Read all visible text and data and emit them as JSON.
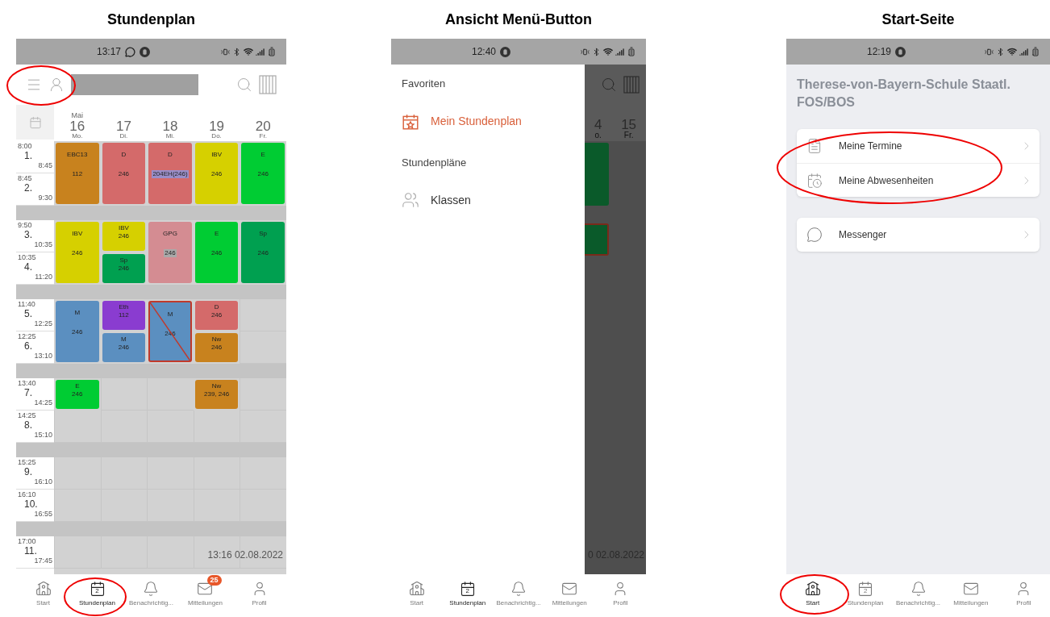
{
  "timetable_screen": {
    "caption": "Stundenplan",
    "status_bar": {
      "time": "13:17",
      "notification_icons": [
        {
          "kind": "chat"
        },
        {
          "kind": "shield"
        }
      ]
    },
    "rows": [
      {
        "kind": "period",
        "start": "8:00",
        "number": "1.",
        "end": "8:45"
      },
      {
        "kind": "period",
        "start": "8:45",
        "number": "2.",
        "end": "9:30"
      },
      {
        "kind": "break"
      },
      {
        "kind": "period",
        "start": "9:50",
        "number": "3.",
        "end": "10:35"
      },
      {
        "kind": "period",
        "start": "10:35",
        "number": "4.",
        "end": "11:20"
      },
      {
        "kind": "break"
      },
      {
        "kind": "period",
        "start": "11:40",
        "number": "5.",
        "end": "12:25"
      },
      {
        "kind": "period",
        "start": "12:25",
        "number": "6.",
        "end": "13:10"
      },
      {
        "kind": "break"
      },
      {
        "kind": "period",
        "start": "13:40",
        "number": "7.",
        "end": "14:25"
      },
      {
        "kind": "period",
        "start": "14:25",
        "number": "8.",
        "end": "15:10"
      },
      {
        "kind": "break"
      },
      {
        "kind": "period",
        "start": "15:25",
        "number": "9.",
        "end": "16:10"
      },
      {
        "kind": "period",
        "start": "16:10",
        "number": "10.",
        "end": "16:55"
      },
      {
        "kind": "break"
      },
      {
        "kind": "period",
        "start": "17:00",
        "number": "11.",
        "end": "17:45"
      }
    ],
    "days": [
      {
        "month": "Mai",
        "date": "16",
        "weekday": "Mo.",
        "slots": [
          {
            "kind": "lesson",
            "subject": "EBC13",
            "room": "112",
            "color": "#c8821e",
            "cancelled": false
          },
          {
            "kind": "continued"
          },
          {
            "kind": "lesson",
            "subject": "IBV",
            "room": "246",
            "color": "#d6d000",
            "cancelled": false
          },
          {
            "kind": "continued"
          },
          {
            "kind": "lesson",
            "subject": "M",
            "room": "246",
            "color": "#5b8fc0",
            "cancelled": false
          },
          {
            "kind": "continued"
          },
          {
            "kind": "lesson",
            "subject": "E",
            "room": "246",
            "color": "#00cc33",
            "cancelled": false
          },
          {
            "kind": "free"
          },
          {
            "kind": "free"
          },
          {
            "kind": "free"
          },
          {
            "kind": "free"
          }
        ]
      },
      {
        "date": "17",
        "weekday": "Di.",
        "slots": [
          {
            "kind": "lesson",
            "subject": "D",
            "room": "246",
            "color": "#d46a6a",
            "cancelled": false
          },
          {
            "kind": "continued"
          },
          {
            "kind": "lesson",
            "subject": "IBV",
            "room": "246",
            "color": "#d6d000",
            "cancelled": false
          },
          {
            "kind": "lesson",
            "subject": "Sp",
            "room": "246",
            "color": "#00a050",
            "cancelled": false
          },
          {
            "kind": "lesson",
            "subject": "Eth",
            "room": "112",
            "color": "#8a3cd0",
            "cancelled": false
          },
          {
            "kind": "lesson",
            "subject": "M",
            "room": "246",
            "color": "#5b8fc0",
            "cancelled": false
          },
          {
            "kind": "free"
          },
          {
            "kind": "free"
          },
          {
            "kind": "free"
          },
          {
            "kind": "free"
          },
          {
            "kind": "free"
          }
        ]
      },
      {
        "date": "18",
        "weekday": "Mi.",
        "slots": [
          {
            "kind": "lesson",
            "subject": "D",
            "room": "204EH(246)",
            "room_changed": true,
            "color": "#d46a6a",
            "cancelled": false
          },
          {
            "kind": "continued"
          },
          {
            "kind": "lesson",
            "subject": "GPG",
            "room": "246",
            "room_marked": true,
            "color": "#d48c92",
            "cancelled": false
          },
          {
            "kind": "continued"
          },
          {
            "kind": "lesson",
            "subject": "M",
            "room": "246",
            "color": "#5b8fc0",
            "cancelled": true
          },
          {
            "kind": "continued"
          },
          {
            "kind": "free"
          },
          {
            "kind": "free"
          },
          {
            "kind": "free"
          },
          {
            "kind": "free"
          },
          {
            "kind": "free"
          }
        ]
      },
      {
        "date": "19",
        "weekday": "Do.",
        "slots": [
          {
            "kind": "lesson",
            "subject": "IBV",
            "room": "246",
            "color": "#d6d000",
            "cancelled": false
          },
          {
            "kind": "continued"
          },
          {
            "kind": "lesson",
            "subject": "E",
            "room": "246",
            "color": "#00cc33",
            "cancelled": false
          },
          {
            "kind": "continued"
          },
          {
            "kind": "lesson",
            "subject": "D",
            "room": "246",
            "color": "#d46a6a",
            "cancelled": false
          },
          {
            "kind": "lesson",
            "subject": "Nw",
            "room": "246",
            "color": "#c8821e",
            "cancelled": false
          },
          {
            "kind": "lesson",
            "subject": "Nw",
            "room": "239, 246",
            "color": "#c8821e",
            "cancelled": false
          },
          {
            "kind": "free"
          },
          {
            "kind": "free"
          },
          {
            "kind": "free"
          },
          {
            "kind": "free"
          }
        ]
      },
      {
        "date": "20",
        "weekday": "Fr.",
        "slots": [
          {
            "kind": "lesson",
            "subject": "E",
            "room": "246",
            "color": "#00cc33",
            "cancelled": false
          },
          {
            "kind": "continued"
          },
          {
            "kind": "lesson",
            "subject": "Sp",
            "room": "246",
            "color": "#00a050",
            "cancelled": false
          },
          {
            "kind": "continued"
          },
          {
            "kind": "free"
          },
          {
            "kind": "free"
          },
          {
            "kind": "free"
          },
          {
            "kind": "free"
          },
          {
            "kind": "free"
          },
          {
            "kind": "free"
          },
          {
            "kind": "free"
          }
        ]
      }
    ],
    "timestamp": "13:16 02.08.2022",
    "tab_bar": [
      {
        "kind": "home",
        "label": "Start",
        "selected": false
      },
      {
        "kind": "calendar",
        "label": "Stundenplan",
        "icon_text": "2",
        "selected": true
      },
      {
        "kind": "bell",
        "label": "Benachrichtig...",
        "selected": false
      },
      {
        "kind": "mail",
        "label": "Mitteilungen",
        "badge": "25",
        "selected": false
      },
      {
        "kind": "profile",
        "label": "Profil",
        "selected": false
      }
    ]
  },
  "menu_screen": {
    "caption": "Ansicht Menü-Button",
    "status_bar": {
      "time": "12:40",
      "notification_icons": [
        {
          "kind": "shield"
        }
      ]
    },
    "drawer": [
      {
        "kind": "section",
        "label": "Favoriten"
      },
      {
        "kind": "favorite",
        "label": "Mein Stundenplan",
        "selected": true
      },
      {
        "kind": "section",
        "label": "Stundenpläne"
      },
      {
        "kind": "classes",
        "label": "Klassen",
        "selected": false
      }
    ],
    "background_days": [
      {
        "date": "4",
        "weekday": "o."
      },
      {
        "date": "15",
        "weekday": "Fr."
      }
    ],
    "background_timestamp": "0 02.08.2022",
    "tab_bar": [
      {
        "kind": "home",
        "label": "Start",
        "selected": false
      },
      {
        "kind": "calendar",
        "label": "Stundenplan",
        "icon_text": "2",
        "selected": true
      },
      {
        "kind": "bell",
        "label": "Benachrichtig...",
        "selected": false
      },
      {
        "kind": "mail",
        "label": "Mitteilungen",
        "selected": false
      },
      {
        "kind": "profile",
        "label": "Profil",
        "selected": false
      }
    ]
  },
  "start_screen": {
    "caption": "Start-Seite",
    "status_bar": {
      "time": "12:19",
      "notification_icons": [
        {
          "kind": "shield"
        }
      ]
    },
    "title": "Therese-von-Bayern-Schule Staatl. FOS/BOS",
    "cards": [
      {
        "items": [
          {
            "kind": "appointments",
            "label": "Meine Termine"
          },
          {
            "kind": "absences",
            "label": "Meine Abwesenheiten"
          }
        ]
      },
      {
        "items": [
          {
            "kind": "messenger",
            "label": "Messenger"
          }
        ]
      }
    ],
    "tab_bar": [
      {
        "kind": "home",
        "label": "Start",
        "selected": true
      },
      {
        "kind": "calendar",
        "label": "Stundenplan",
        "icon_text": "2",
        "selected": false
      },
      {
        "kind": "bell",
        "label": "Benachrichtig...",
        "selected": false
      },
      {
        "kind": "mail",
        "label": "Mitteilungen",
        "selected": false
      },
      {
        "kind": "profile",
        "label": "Profil",
        "selected": false
      }
    ]
  }
}
